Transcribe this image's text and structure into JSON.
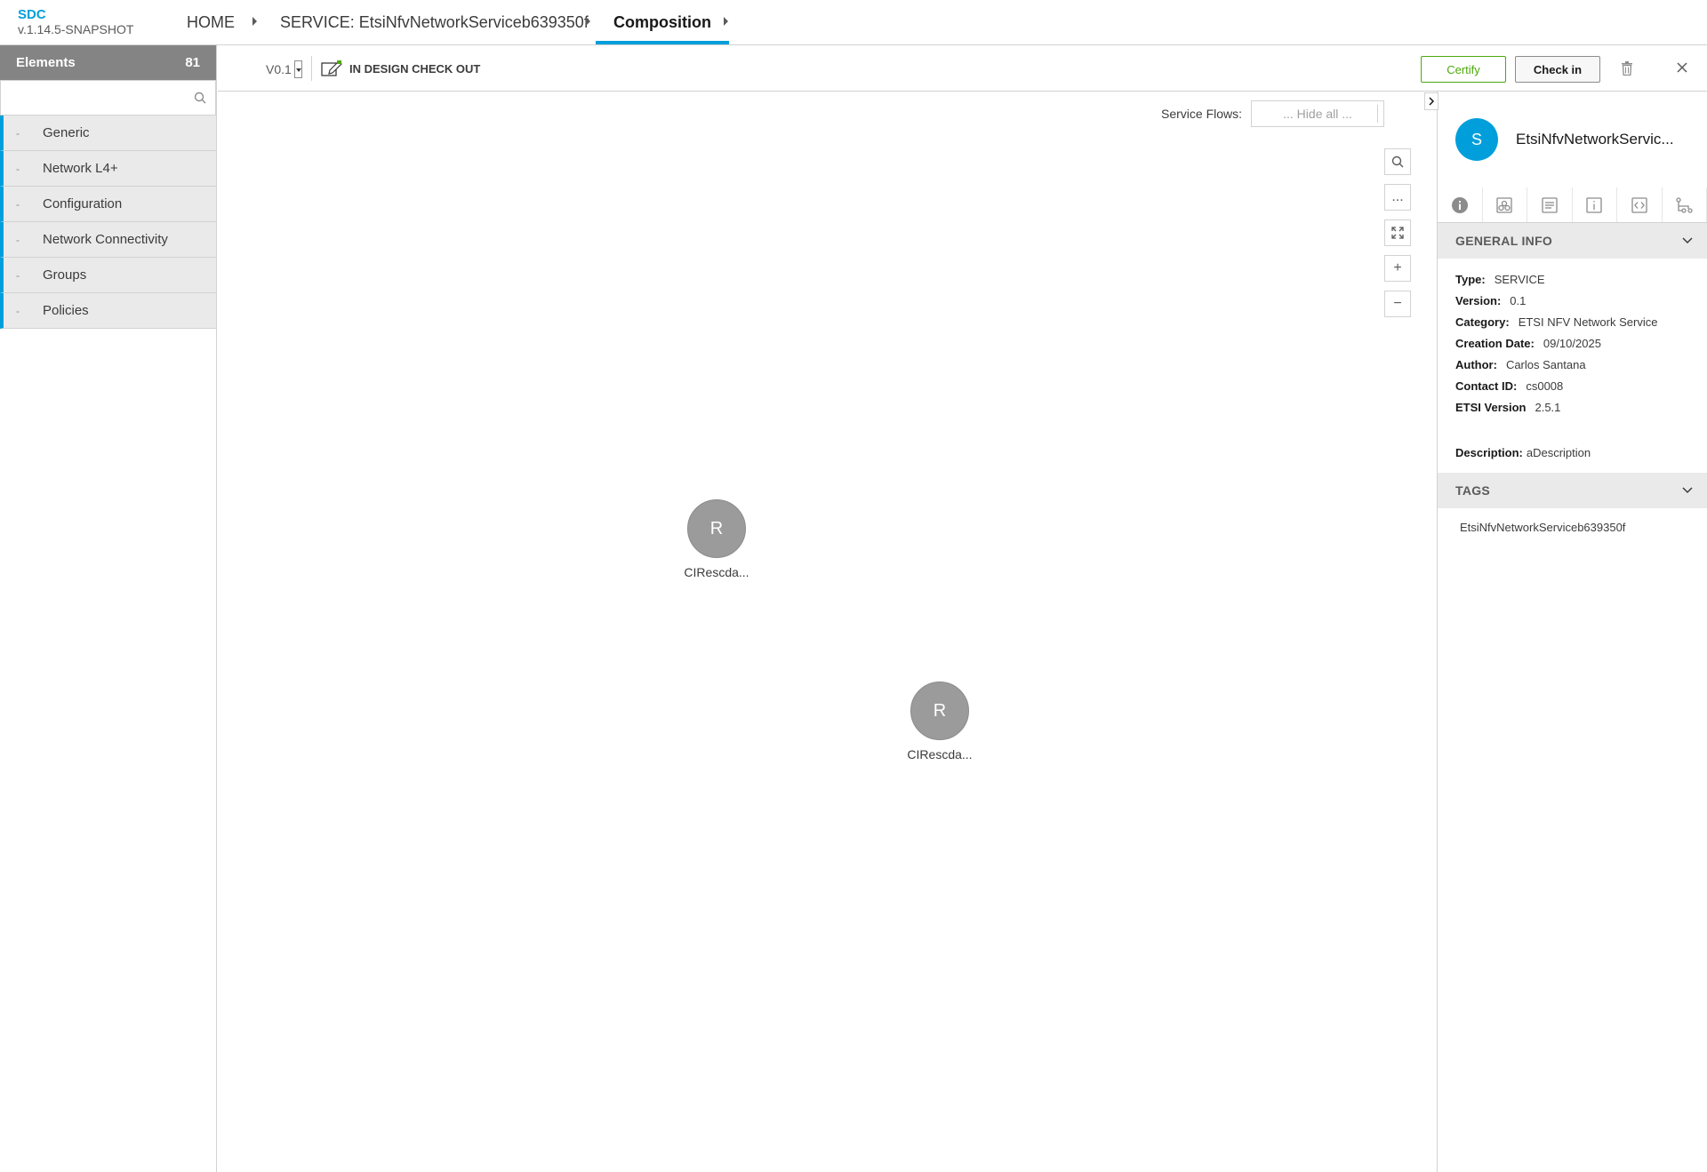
{
  "app": {
    "name": "SDC",
    "version": "v.1.14.5-SNAPSHOT"
  },
  "breadcrumb": {
    "home": "HOME",
    "service": "SERVICE: EtsiNfvNetworkServiceb639350f",
    "current": "Composition"
  },
  "palette": {
    "title": "Elements",
    "count": "81",
    "search_placeholder": "",
    "groups": [
      {
        "label": "Generic"
      },
      {
        "label": "Network L4+"
      },
      {
        "label": "Configuration"
      },
      {
        "label": "Network Connectivity"
      },
      {
        "label": "Groups"
      },
      {
        "label": "Policies"
      }
    ],
    "group_marker": "-"
  },
  "toolbar": {
    "version": "V0.1",
    "status": "IN DESIGN CHECK OUT",
    "certify_label": "Certify",
    "checkin_label": "Check in"
  },
  "canvas": {
    "service_flows_label": "Service Flows:",
    "service_flows_value": "... Hide all ...",
    "zoom_tools": {
      "search": "search-icon",
      "more": "...",
      "fit": "fit-screen-icon",
      "zoom_in": "+",
      "zoom_out": "−"
    },
    "nodes": [
      {
        "letter": "R",
        "label": "CIRescda..."
      },
      {
        "letter": "R",
        "label": "CIRescda..."
      }
    ]
  },
  "details": {
    "avatar": "S",
    "title": "EtsiNfvNetworkServic...",
    "general_info_title": "GENERAL INFO",
    "fields": [
      {
        "key": "Type:",
        "value": "SERVICE"
      },
      {
        "key": "Version:",
        "value": "0.1"
      },
      {
        "key": "Category:",
        "value": "ETSI NFV Network Service"
      },
      {
        "key": "Creation Date:",
        "value": "09/10/2025"
      },
      {
        "key": "Author:",
        "value": "Carlos Santana"
      },
      {
        "key": "Contact ID:",
        "value": "cs0008"
      },
      {
        "key": "ETSI Version",
        "value": "2.5.1"
      }
    ],
    "description": {
      "key": "Description:",
      "value": "aDescription"
    },
    "tags_title": "TAGS",
    "tags": [
      "EtsiNfvNetworkServiceb639350f"
    ]
  },
  "colors": {
    "accent": "#009fdb",
    "certify": "#4ca90c",
    "palette_header": "#848484",
    "node": "#9b9b9b"
  }
}
